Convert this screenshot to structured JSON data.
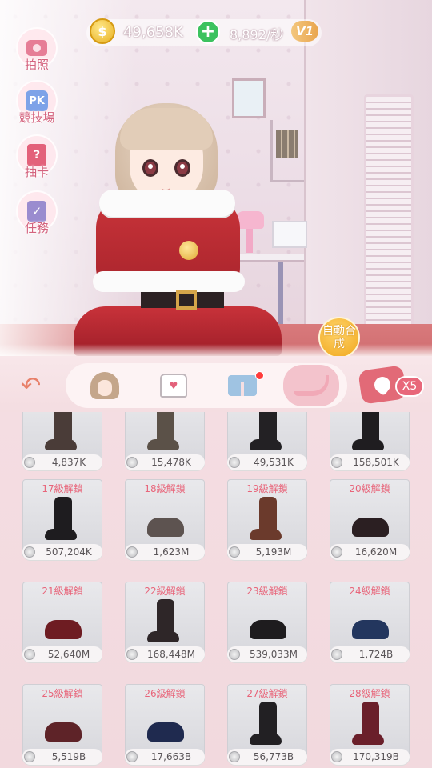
{
  "currency": {
    "coin_icon": "$",
    "coins": "49,658K",
    "plus_icon": "+",
    "rate": "8,892/秒",
    "vip": "V1"
  },
  "side_menu": [
    {
      "id": "photo",
      "label": "拍照",
      "icon": "camera-icon"
    },
    {
      "id": "arena",
      "label": "競技場",
      "icon": "pk-icon",
      "icon_text": "PK"
    },
    {
      "id": "draw",
      "label": "抽卡",
      "icon": "card-icon",
      "icon_text": "?"
    },
    {
      "id": "task",
      "label": "任務",
      "icon": "task-icon",
      "icon_text": "✓"
    }
  ],
  "auto_button": {
    "label": "自動合成"
  },
  "categories": {
    "back_icon": "↶",
    "items": [
      {
        "id": "hair",
        "icon": "hair-icon",
        "active": false
      },
      {
        "id": "top",
        "icon": "shirt-icon",
        "icon_text": "♥",
        "active": false
      },
      {
        "id": "bottom",
        "icon": "shorts-icon",
        "active": false,
        "badge": true
      },
      {
        "id": "shoes",
        "icon": "heels-icon",
        "active": true
      }
    ],
    "reward_multiplier": "X5"
  },
  "items": [
    {
      "unlock": "",
      "price": "4,837K",
      "color": "#4a3c38",
      "kind": "boot"
    },
    {
      "unlock": "",
      "price": "15,478K",
      "color": "#5b5148",
      "kind": "boot"
    },
    {
      "unlock": "",
      "price": "49,531K",
      "color": "#232124",
      "kind": "boot"
    },
    {
      "unlock": "",
      "price": "158,501K",
      "color": "#1f1d20",
      "kind": "boot"
    },
    {
      "unlock": "17級解鎖",
      "price": "507,204K",
      "color": "#1e1c1f",
      "kind": "boot"
    },
    {
      "unlock": "18級解鎖",
      "price": "1,623M",
      "color": "#5d5350",
      "kind": "low"
    },
    {
      "unlock": "19級解鎖",
      "price": "5,193M",
      "color": "#6b3a2c",
      "kind": "boot"
    },
    {
      "unlock": "20級解鎖",
      "price": "16,620M",
      "color": "#2b1f22",
      "kind": "low"
    },
    {
      "unlock": "21級解鎖",
      "price": "52,640M",
      "color": "#6e1c22",
      "kind": "low"
    },
    {
      "unlock": "22級解鎖",
      "price": "168,448M",
      "color": "#2e2628",
      "kind": "boot"
    },
    {
      "unlock": "23級解鎖",
      "price": "539,033M",
      "color": "#1e1c1e",
      "kind": "low"
    },
    {
      "unlock": "24級解鎖",
      "price": "1,724B",
      "color": "#23365e",
      "kind": "low"
    },
    {
      "unlock": "25級解鎖",
      "price": "5,519B",
      "color": "#5e2328",
      "kind": "low"
    },
    {
      "unlock": "26級解鎖",
      "price": "17,663B",
      "color": "#1f2a4f",
      "kind": "low"
    },
    {
      "unlock": "27級解鎖",
      "price": "56,773B",
      "color": "#222023",
      "kind": "boot"
    },
    {
      "unlock": "28級解鎖",
      "price": "170,319B",
      "color": "#6a1f2a",
      "kind": "boot"
    }
  ]
}
